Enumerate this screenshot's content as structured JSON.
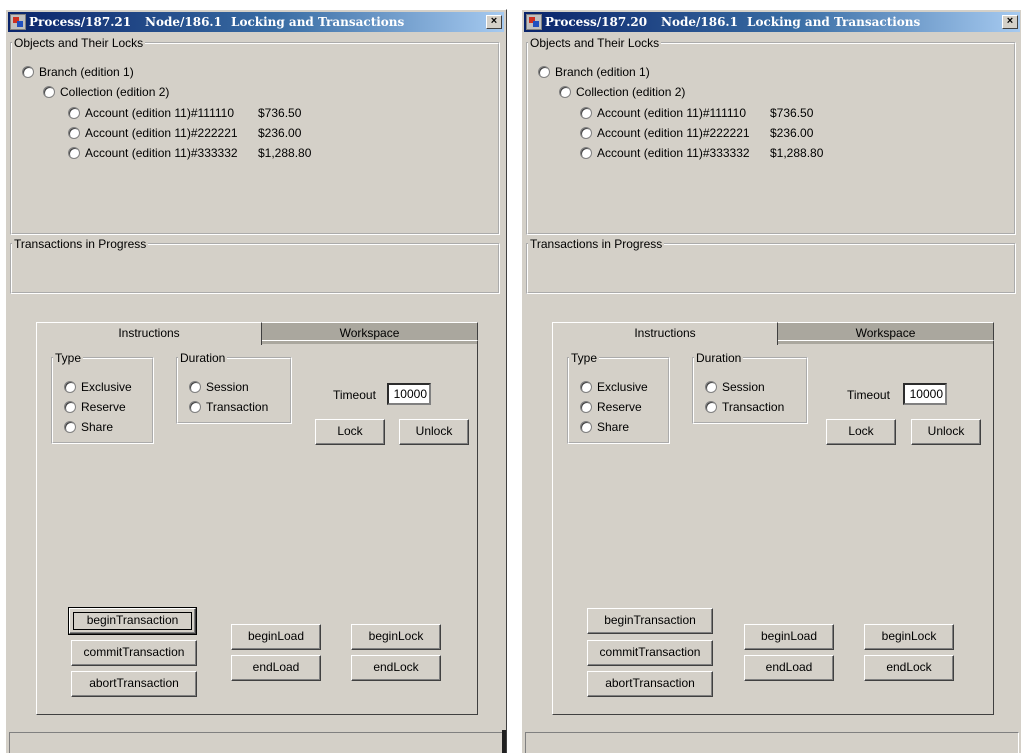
{
  "windows": [
    {
      "title": {
        "process": "Process/187.21",
        "node": "Node/186.1",
        "heading": "Locking and Transactions"
      },
      "close_label": "×",
      "objects_legend": "Objects and Their Locks",
      "tree": [
        {
          "label": "Branch (edition 1)"
        },
        {
          "label": "Collection (edition 2)"
        },
        {
          "label": "Account (edition 11)",
          "number": "#111110",
          "balance": "$736.50"
        },
        {
          "label": "Account (edition 11)",
          "number": "#222221",
          "balance": "$236.00"
        },
        {
          "label": "Account (edition 11)",
          "number": "#333332",
          "balance": "$1,288.80"
        }
      ],
      "transactions_legend": "Transactions in Progress",
      "tabs": [
        "Instructions",
        "Workspace"
      ],
      "type_legend": "Type",
      "type_options": [
        "Exclusive",
        "Reserve",
        "Share"
      ],
      "duration_legend": "Duration",
      "duration_options": [
        "Session",
        "Transaction"
      ],
      "timeout_label": "Timeout",
      "timeout_value": "10000",
      "lock_label": "Lock",
      "unlock_label": "Unlock",
      "buttons": {
        "begin_transaction": "beginTransaction",
        "commit_transaction": "commitTransaction",
        "abort_transaction": "abortTransaction",
        "begin_load": "beginLoad",
        "end_load": "endLoad",
        "begin_lock": "beginLock",
        "end_lock": "endLock"
      }
    },
    {
      "title": {
        "process": "Process/187.20",
        "node": "Node/186.1",
        "heading": "Locking and Transactions"
      },
      "close_label": "×",
      "objects_legend": "Objects and Their Locks",
      "tree": [
        {
          "label": "Branch (edition 1)"
        },
        {
          "label": "Collection (edition 2)"
        },
        {
          "label": "Account (edition 11)",
          "number": "#111110",
          "balance": "$736.50"
        },
        {
          "label": "Account (edition 11)",
          "number": "#222221",
          "balance": "$236.00"
        },
        {
          "label": "Account (edition 11)",
          "number": "#333332",
          "balance": "$1,288.80"
        }
      ],
      "transactions_legend": "Transactions in Progress",
      "tabs": [
        "Instructions",
        "Workspace"
      ],
      "type_legend": "Type",
      "type_options": [
        "Exclusive",
        "Reserve",
        "Share"
      ],
      "duration_legend": "Duration",
      "duration_options": [
        "Session",
        "Transaction"
      ],
      "timeout_label": "Timeout",
      "timeout_value": "10000",
      "lock_label": "Lock",
      "unlock_label": "Unlock",
      "buttons": {
        "begin_transaction": "beginTransaction",
        "commit_transaction": "commitTransaction",
        "abort_transaction": "abortTransaction",
        "begin_load": "beginLoad",
        "end_load": "endLoad",
        "begin_lock": "beginLock",
        "end_lock": "endLock"
      }
    }
  ]
}
